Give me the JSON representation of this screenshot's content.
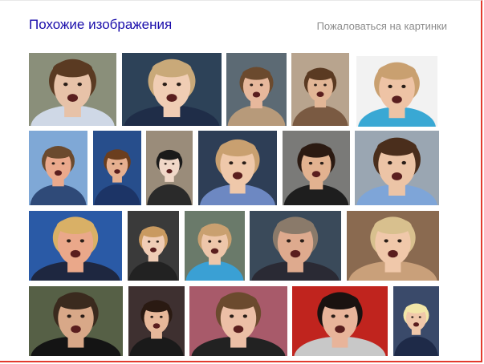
{
  "header": {
    "title": "Похожие изображения",
    "report_link": "Пожаловаться на картинки"
  },
  "thumbnail_count": 21
}
